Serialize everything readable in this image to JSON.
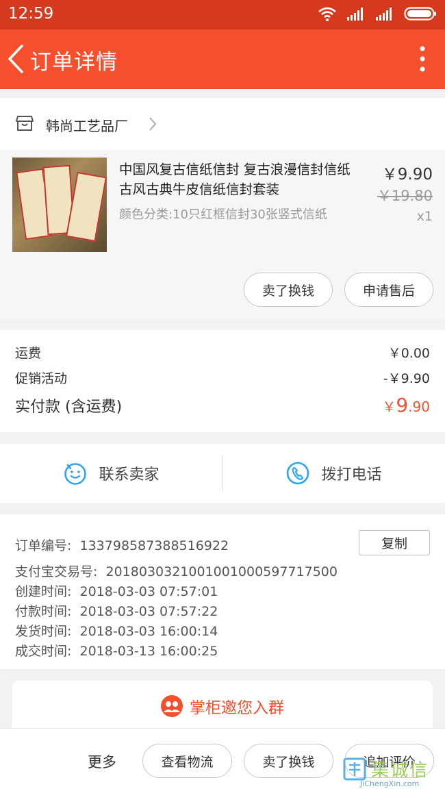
{
  "status_bar": {
    "time": "12:59"
  },
  "nav": {
    "title": "订单详情"
  },
  "shop": {
    "name": "韩尚工艺品厂"
  },
  "item": {
    "title": "中国风复古信纸信封 复古浪漫信封信纸 古风古典牛皮信纸信封套装",
    "spec": "颜色分类:10只红框信封30张竖式信纸",
    "price": "￥9.90",
    "original_price": "￥19.80",
    "quantity": "x1",
    "btn_sell": "卖了换钱",
    "btn_aftersale": "申请售后"
  },
  "fees": {
    "shipping_label": "运费",
    "shipping_value": "￥0.00",
    "promo_label": "促销活动",
    "promo_value": "-￥9.90",
    "total_label": "实付款 (含运费)",
    "total_currency": "￥",
    "total_int": "9",
    "total_dec": ".90"
  },
  "contact": {
    "seller_label": "联系卖家",
    "call_label": "拨打电话"
  },
  "order_info": {
    "copy_label": "复制",
    "rows": [
      {
        "key": "订单编号:",
        "value": "133798587388516922"
      },
      {
        "key": "支付宝交易号:",
        "value": "2018030321001001000597717500"
      },
      {
        "key": "创建时间:",
        "value": "2018-03-03 07:57:01"
      },
      {
        "key": "付款时间:",
        "value": "2018-03-03 07:57:22"
      },
      {
        "key": "发货时间:",
        "value": "2018-03-03 16:00:14"
      },
      {
        "key": "成交时间:",
        "value": "2018-03-13 16:00:25"
      }
    ]
  },
  "group": {
    "label": "掌柜邀您入群"
  },
  "bottom_bar": {
    "more": "更多",
    "btn_logistics": "查看物流",
    "btn_sell": "卖了换钱",
    "btn_review": "追加评价"
  },
  "watermark": {
    "cn": "集诚信",
    "en": "JiChengXin.com"
  },
  "colors": {
    "accent": "#f4502e",
    "status_bar": "#d63a1e",
    "icon_blue": "#2ea3f2"
  }
}
